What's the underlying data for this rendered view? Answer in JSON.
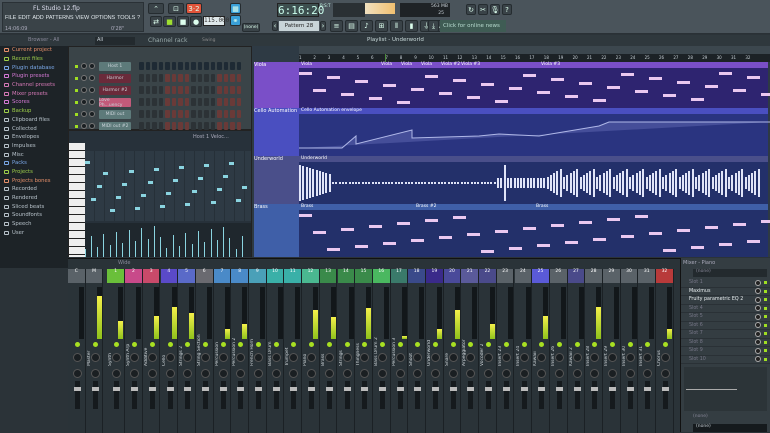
{
  "app": {
    "title": "FL Studio 12.flp",
    "menu": [
      "FILE",
      "EDIT",
      "ADD",
      "PATTERNS",
      "VIEW",
      "OPTIONS",
      "TOOLS",
      "?"
    ],
    "hint_time": "14:06:09",
    "hint_right": "0'28\""
  },
  "transport": {
    "tempo": "115.000",
    "time": "6:16:20",
    "time_unit": "B:S:T",
    "pattern": "Pattern 28",
    "snap": "(none)",
    "cpu_mem": "563 MB",
    "polyphony": "25",
    "news": "Click for online news"
  },
  "browser": {
    "header": "Browser - All",
    "items": [
      {
        "label": "Current project",
        "color": "#e8906a"
      },
      {
        "label": "Recent files",
        "color": "#9fd04a"
      },
      {
        "label": "Plugin database",
        "color": "#7aa8e8"
      },
      {
        "label": "Plugin presets",
        "color": "#d87ad8"
      },
      {
        "label": "Channel presets",
        "color": "#d87ab8"
      },
      {
        "label": "Mixer presets",
        "color": "#d87ab8"
      },
      {
        "label": "Scores",
        "color": "#d87ad8"
      },
      {
        "label": "Backup",
        "color": "#9fd04a"
      },
      {
        "label": "Clipboard files",
        "color": "#b9c4cc"
      },
      {
        "label": "Collected",
        "color": "#b9c4cc"
      },
      {
        "label": "Envelopes",
        "color": "#b9c4cc"
      },
      {
        "label": "Impulses",
        "color": "#b9c4cc"
      },
      {
        "label": "Misc",
        "color": "#b9c4cc"
      },
      {
        "label": "Packs",
        "color": "#7aa8e8"
      },
      {
        "label": "Projects",
        "color": "#9fd04a"
      },
      {
        "label": "Projects bones",
        "color": "#e8906a"
      },
      {
        "label": "Recorded",
        "color": "#b9c4cc"
      },
      {
        "label": "Rendered",
        "color": "#b9c4cc"
      },
      {
        "label": "Sliced beats",
        "color": "#b9c4cc"
      },
      {
        "label": "Soundfonts",
        "color": "#b9c4cc"
      },
      {
        "label": "Speech",
        "color": "#b9c4cc"
      },
      {
        "label": "User",
        "color": "#b9c4cc"
      }
    ]
  },
  "channel_rack": {
    "title": "Channel rack",
    "filter": "All",
    "swing_label": "Swing",
    "channels": [
      {
        "name": "Host 1",
        "color": "#5d7a7a"
      },
      {
        "name": "Harmor",
        "color": "#6a2a3a"
      },
      {
        "name": "Harmor #2",
        "color": "#6a2a3a"
      },
      {
        "name": "Love Ph...uency",
        "color": "#c25a7a"
      },
      {
        "name": "MIDI out",
        "color": "#5d7a7a"
      },
      {
        "name": "MIDI out #2",
        "color": "#5d7a7a"
      }
    ]
  },
  "piano_roll": {
    "title": "Host 1 Veloc..."
  },
  "playlist": {
    "title": "Playlist - Underworld",
    "bars": [
      "1",
      "2",
      "3",
      "4",
      "5",
      "6",
      "7",
      "8",
      "9",
      "10",
      "11",
      "12",
      "13",
      "14",
      "15",
      "16",
      "17",
      "18",
      "19",
      "20",
      "21",
      "22",
      "23",
      "24",
      "25",
      "26",
      "27",
      "28",
      "29",
      "30",
      "31",
      "32"
    ],
    "tracks": [
      {
        "name": "Viola",
        "clips": [
          "Viola",
          "Viola",
          "Viola",
          "Viola",
          "Viola #2",
          "Viola #3",
          "Viola #3"
        ],
        "color": "#7a4fc8"
      },
      {
        "name": "Cello Automation",
        "clips": [
          "Cello Automation envelope"
        ],
        "color": "#4a4fc0"
      },
      {
        "name": "Underworld",
        "clips": [
          "Underworld"
        ],
        "color": "#4a4f8a"
      },
      {
        "name": "Brass",
        "clips": [
          "Brass",
          "Brass #2",
          "Brass"
        ],
        "color": "#3f5fa8"
      }
    ]
  },
  "mixer": {
    "title": "Wide",
    "tracks": [
      {
        "num": "C",
        "name": "",
        "color": "#5a6268",
        "level": 0
      },
      {
        "num": "M",
        "name": "Master",
        "color": "#5a6268",
        "level": 0.82
      },
      {
        "num": "1",
        "name": "Synth",
        "color": "#6abf3a",
        "level": 0.35
      },
      {
        "num": "2",
        "name": "Synth Arp",
        "color": "#c84a8a",
        "level": 0
      },
      {
        "num": "3",
        "name": "Additive",
        "color": "#c84a6a",
        "level": 0.45
      },
      {
        "num": "4",
        "name": "Cello",
        "color": "#5a4ac8",
        "level": 0.62
      },
      {
        "num": "5",
        "name": "Strings 2",
        "color": "#5a6ac8",
        "level": 0.5
      },
      {
        "num": "6",
        "name": "String Section",
        "color": "#6a6a70",
        "level": 0
      },
      {
        "num": "7",
        "name": "Percussion",
        "color": "#4a8ac8",
        "level": 0.2
      },
      {
        "num": "8",
        "name": "Percussion 2",
        "color": "#4a8ac8",
        "level": 0.28
      },
      {
        "num": "9",
        "name": "French Horn",
        "color": "#4aa0b8",
        "level": 0
      },
      {
        "num": "10",
        "name": "Bass Drum",
        "color": "#3ab0a8",
        "level": 0
      },
      {
        "num": "11",
        "name": "Trumpet",
        "color": "#3ab0a8",
        "level": 0
      },
      {
        "num": "12",
        "name": "Piano",
        "color": "#4ab890",
        "level": 0.55
      },
      {
        "num": "13",
        "name": "Brass",
        "color": "#3a8a4a",
        "level": 0.42
      },
      {
        "num": "14",
        "name": "Strings",
        "color": "#3a8a4a",
        "level": 0
      },
      {
        "num": "15",
        "name": "Thingness",
        "color": "#3a8a4a",
        "level": 0.6
      },
      {
        "num": "16",
        "name": "Bass Drum 2",
        "color": "#4ab860",
        "level": 0
      },
      {
        "num": "17",
        "name": "Percussion 3",
        "color": "#3a7a6a",
        "level": 0.05
      },
      {
        "num": "18",
        "name": "Shoot",
        "color": "#3a4a8a",
        "level": 0
      },
      {
        "num": "19",
        "name": "Underworld",
        "color": "#3a2a8a",
        "level": 0.2
      },
      {
        "num": "20",
        "name": "Snare",
        "color": "#4a4a9a",
        "level": 0.55
      },
      {
        "num": "21",
        "name": "Arpeggiator",
        "color": "#5a5a9a",
        "level": 0
      },
      {
        "num": "22",
        "name": "Vocoder 2",
        "color": "#4a4a8a",
        "level": 0.28
      },
      {
        "num": "23",
        "name": "Insert 23",
        "color": "#5a6268",
        "level": 0
      },
      {
        "num": "24",
        "name": "Insert 24",
        "color": "#5a6268",
        "level": 0
      },
      {
        "num": "25",
        "name": "Kawaii",
        "color": "#5a5ad8",
        "level": 0.45
      },
      {
        "num": "26",
        "name": "Insert 26",
        "color": "#5a6268",
        "level": 0
      },
      {
        "num": "27",
        "name": "Kawaii 2",
        "color": "#4a4a8a",
        "level": 0
      },
      {
        "num": "28",
        "name": "Insert 28",
        "color": "#5a6268",
        "level": 0.62
      },
      {
        "num": "29",
        "name": "Insert 29",
        "color": "#5a6268",
        "level": 0
      },
      {
        "num": "30",
        "name": "Insert 30",
        "color": "#5a6268",
        "level": 0
      },
      {
        "num": "31",
        "name": "Insert 31",
        "color": "#5a6268",
        "level": 0
      },
      {
        "num": "32",
        "name": "Chorus",
        "color": "#b83a3a",
        "level": 0.2
      }
    ]
  },
  "mixer_panel": {
    "title": "Mixer - Piano",
    "input": "(none)",
    "slots": [
      "Slot 1",
      "Maximus",
      "Fruity parametric EQ 2",
      "Slot 4",
      "Slot 5",
      "Slot 6",
      "Slot 7",
      "Slot 8",
      "Slot 9",
      "Slot 10"
    ],
    "sidechain": "(none)",
    "output": "(none)"
  }
}
